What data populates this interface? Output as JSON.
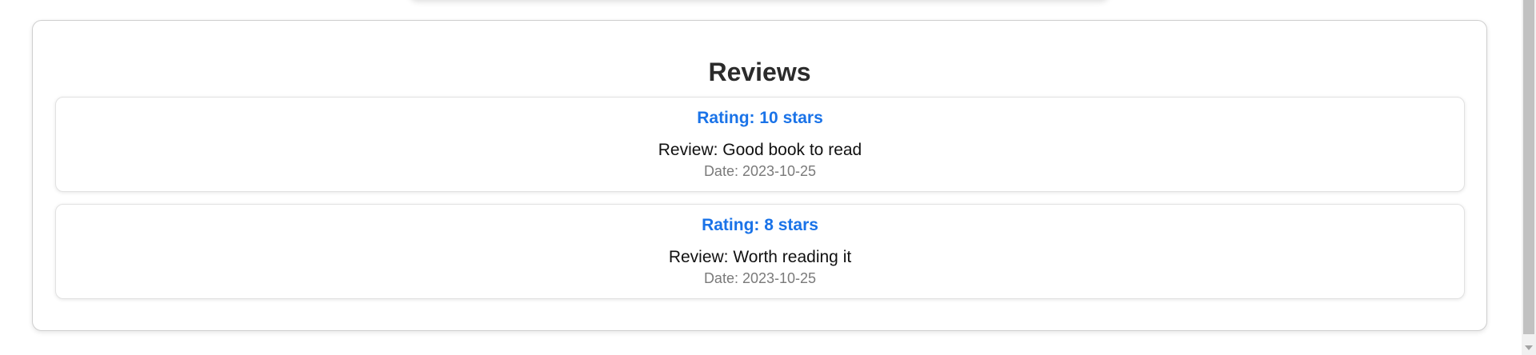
{
  "reviews": {
    "title": "Reviews",
    "items": [
      {
        "rating": "Rating: 10 stars",
        "review": "Review: Good book to read",
        "date": "Date: 2023-10-25"
      },
      {
        "rating": "Rating: 8 stars",
        "review": "Review: Worth reading it",
        "date": "Date: 2023-10-25"
      }
    ]
  },
  "colors": {
    "rating": "#1a73e8",
    "title": "#2b2b2b",
    "date": "#7a7a7a"
  },
  "icons": {
    "scroll_down": "scroll-down-arrow-icon"
  }
}
